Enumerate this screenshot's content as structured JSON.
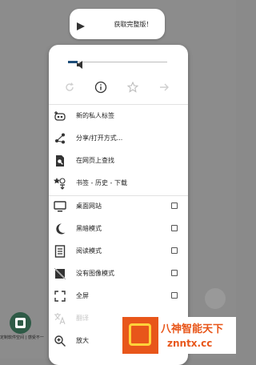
{
  "toast": {
    "label": "获取完整版！"
  },
  "nav": {
    "refresh_icon": "refresh-icon",
    "info_icon": "info-icon",
    "star_icon": "star-icon",
    "forward_icon": "forward-arrow-icon"
  },
  "volume_level": 0.1,
  "menu": {
    "items": [
      {
        "label": "新的私人标签",
        "icon": "private-tab-icon",
        "checkbox": false
      },
      {
        "label": "分享/打开方式...",
        "icon": "share-icon",
        "checkbox": false
      },
      {
        "label": "在网页上查找",
        "icon": "find-in-page-icon",
        "checkbox": false
      },
      {
        "label": "书签 - 历史 - 下载",
        "icon": "bookmarks-icon",
        "checkbox": false
      },
      {
        "label": "桌面网站",
        "icon": "desktop-icon",
        "checkbox": true,
        "checked": false
      },
      {
        "label": "黑暗模式",
        "icon": "moon-icon",
        "checkbox": true,
        "checked": false
      },
      {
        "label": "阅读模式",
        "icon": "reader-icon",
        "checkbox": true,
        "checked": false
      },
      {
        "label": "没有图像模式",
        "icon": "no-image-icon",
        "checkbox": true,
        "checked": false
      },
      {
        "label": "全屏",
        "icon": "fullscreen-icon",
        "checkbox": true,
        "checked": false
      },
      {
        "label": "翻译",
        "icon": "translate-icon",
        "checkbox": false,
        "disabled": true
      },
      {
        "label": "放大",
        "icon": "zoom-in-icon",
        "checkbox": false
      }
    ]
  },
  "background_app": {
    "label": "定制软件空间 | 感受不一"
  },
  "watermark": {
    "line1": "八神智能天下",
    "line2": "znntx.cc"
  }
}
